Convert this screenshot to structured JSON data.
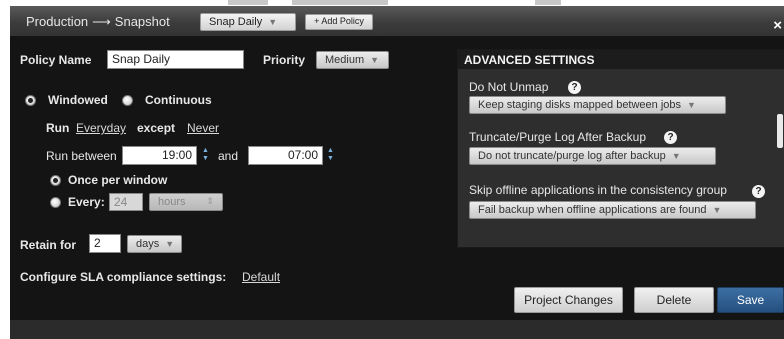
{
  "header": {
    "breadcrumb_start": "Production",
    "arrow": "⟶",
    "breadcrumb_end": "Snapshot",
    "policy_select": "Snap Daily",
    "add_policy": "+ Add Policy",
    "close": "×"
  },
  "policy": {
    "name_label": "Policy Name",
    "name_value": "Snap Daily",
    "priority_label": "Priority",
    "priority_value": "Medium"
  },
  "schedule": {
    "windowed_label": "Windowed",
    "continuous_label": "Continuous",
    "run_label": "Run",
    "run_everyday": "Everyday",
    "except_label": "except",
    "except_never": "Never",
    "run_between_label": "Run between",
    "start_time": "19:00",
    "and_label": "and",
    "end_time": "07:00",
    "once_label": "Once per window",
    "every_label": "Every:",
    "every_value": "24",
    "every_unit": "hours"
  },
  "retention": {
    "label": "Retain for",
    "value": "2",
    "unit": "days"
  },
  "sla": {
    "label": "Configure SLA compliance settings:",
    "link": "Default"
  },
  "advanced": {
    "title": "ADVANCED SETTINGS",
    "unmap_label": "Do Not Unmap",
    "unmap_value": "Keep staging disks mapped between jobs",
    "truncate_label": "Truncate/Purge Log After Backup",
    "truncate_value": "Do not truncate/purge log after backup",
    "skip_label": "Skip offline applications in the consistency group",
    "skip_value": "Fail backup when offline applications are found"
  },
  "actions": {
    "project": "Project Changes",
    "delete": "Delete",
    "save": "Save"
  },
  "colors": {
    "panel_bg": "#141414",
    "save_button": "#2e5a8c",
    "link": "#d8d8d8"
  }
}
